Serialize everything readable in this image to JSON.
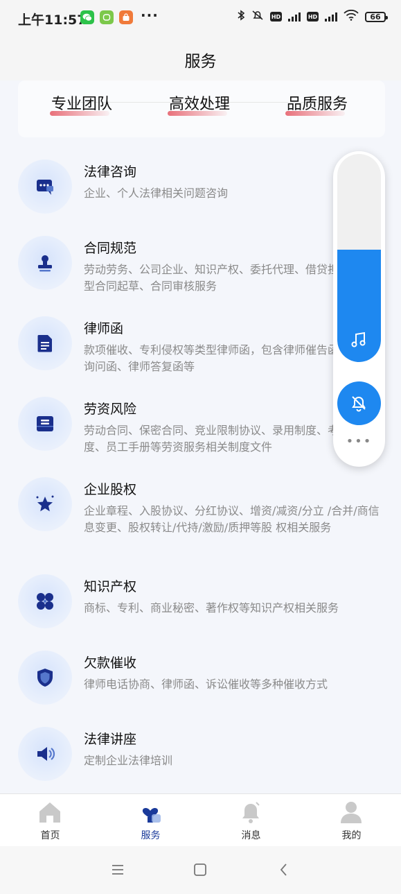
{
  "status_bar": {
    "time": "上午11:57",
    "more": "···",
    "hd1": "HD",
    "hd2": "HD",
    "net1": "4G",
    "net2": "4G",
    "battery": "66"
  },
  "header": {
    "title": "服务"
  },
  "features": [
    "专业团队",
    "高效处理",
    "品质服务"
  ],
  "services": [
    {
      "title": "法律咨询",
      "desc": "企业、个人法律相关问题咨询",
      "icon": "chat-icon"
    },
    {
      "title": "合同规范",
      "desc": "劳动劳务、公司企业、知识产权、委托代理、借贷担保等类型合同起草、合同审核服务",
      "icon": "stamp-icon"
    },
    {
      "title": "律师函",
      "desc": "款项催收、专利侵权等类型律师函，包含律师催告函、律师询问函、律师答复函等",
      "icon": "document-icon"
    },
    {
      "title": "劳资风险",
      "desc": "劳动合同、保密合同、竞业限制协议、录用制度、考勤制度、员工手册等劳资服务相关制度文件",
      "icon": "archive-icon"
    },
    {
      "title": "企业股权",
      "desc": "企业章程、入股协议、分红协议、增资/减资/分立 /合并/商信息变更、股权转让/代持/激励/质押等股 权相关服务",
      "icon": "star-icon"
    },
    {
      "title": "知识产权",
      "desc": "商标、专利、商业秘密、著作权等知识产权相关服务",
      "icon": "clover-icon"
    },
    {
      "title": "欠款催收",
      "desc": "律师电话协商、律师函、诉讼催收等多种催收方式",
      "icon": "shield-icon"
    },
    {
      "title": "法律讲座",
      "desc": "定制企业法律培训",
      "icon": "speaker-icon"
    }
  ],
  "floating_panel": {
    "volume_level": 0.54,
    "more": "•••"
  },
  "tabs": [
    {
      "label": "首页",
      "icon": "home-icon",
      "active": false
    },
    {
      "label": "服务",
      "icon": "service-icon",
      "active": true
    },
    {
      "label": "消息",
      "icon": "bell-icon",
      "active": false
    },
    {
      "label": "我的",
      "icon": "profile-icon",
      "active": false
    }
  ],
  "colors": {
    "accent": "#1e88f0",
    "icon_navy": "#1a2f8c",
    "underline": "#e8707a",
    "active_tab": "#1a3a9a"
  }
}
